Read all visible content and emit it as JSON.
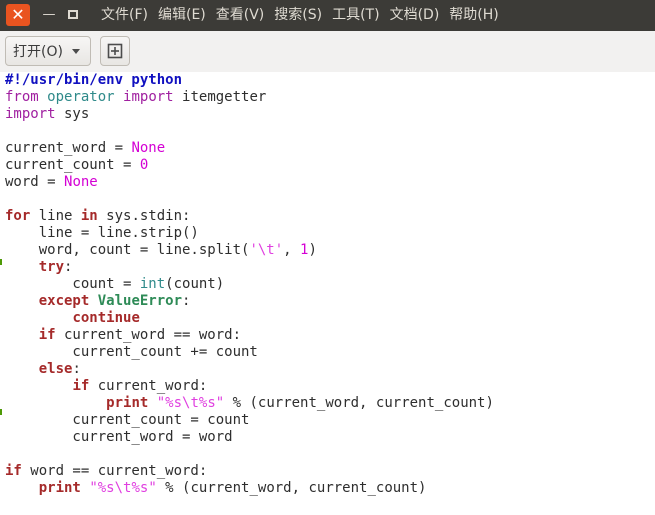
{
  "window": {
    "close_glyph": "✕",
    "minimize_glyph": "—"
  },
  "menu": [
    "文件(F)",
    "编辑(E)",
    "查看(V)",
    "搜索(S)",
    "工具(T)",
    "文档(D)",
    "帮助(H)"
  ],
  "toolbar": {
    "open_label": "打开(O)"
  },
  "editor": {
    "lines": [
      [
        {
          "t": "#!/usr/bin/env python",
          "c": "sb"
        }
      ],
      [
        {
          "t": "from",
          "c": "kw"
        },
        {
          "t": " "
        },
        {
          "t": "operator",
          "c": "bi"
        },
        {
          "t": " "
        },
        {
          "t": "import",
          "c": "kw"
        },
        {
          "t": " itemgetter"
        }
      ],
      [
        {
          "t": "import",
          "c": "kw"
        },
        {
          "t": " sys"
        }
      ],
      [],
      [
        {
          "t": "current_word = "
        },
        {
          "t": "None",
          "c": "num"
        }
      ],
      [
        {
          "t": "current_count = "
        },
        {
          "t": "0",
          "c": "num"
        }
      ],
      [
        {
          "t": "word = "
        },
        {
          "t": "None",
          "c": "num"
        }
      ],
      [],
      [
        {
          "t": "for",
          "c": "kwb"
        },
        {
          "t": " line "
        },
        {
          "t": "in",
          "c": "kwb"
        },
        {
          "t": " sys.stdin:"
        }
      ],
      [
        {
          "t": "    line = line.strip()"
        }
      ],
      [
        {
          "t": "    word, count = line.split("
        },
        {
          "t": "'\\t'",
          "c": "str"
        },
        {
          "t": ", "
        },
        {
          "t": "1",
          "c": "num"
        },
        {
          "t": ")"
        }
      ],
      [
        {
          "t": "    "
        },
        {
          "t": "try",
          "c": "kwb"
        },
        {
          "t": ":"
        }
      ],
      [
        {
          "t": "        count = "
        },
        {
          "t": "int",
          "c": "bi"
        },
        {
          "t": "(count)"
        }
      ],
      [
        {
          "t": "    "
        },
        {
          "t": "except",
          "c": "kwb"
        },
        {
          "t": " "
        },
        {
          "t": "ValueError",
          "c": "exc"
        },
        {
          "t": ":"
        }
      ],
      [
        {
          "t": "        "
        },
        {
          "t": "continue",
          "c": "kwb"
        }
      ],
      [
        {
          "t": "    "
        },
        {
          "t": "if",
          "c": "kwb"
        },
        {
          "t": " current_word == word:"
        }
      ],
      [
        {
          "t": "        current_count += count"
        }
      ],
      [
        {
          "t": "    "
        },
        {
          "t": "else",
          "c": "kwb"
        },
        {
          "t": ":"
        }
      ],
      [
        {
          "t": "        "
        },
        {
          "t": "if",
          "c": "kwb"
        },
        {
          "t": " current_word:"
        }
      ],
      [
        {
          "t": "            "
        },
        {
          "t": "print",
          "c": "kwb"
        },
        {
          "t": " "
        },
        {
          "t": "\"%s\\t%s\"",
          "c": "str"
        },
        {
          "t": " % (current_word, current_count)"
        }
      ],
      [
        {
          "t": "        current_count = count"
        }
      ],
      [
        {
          "t": "        current_word = word"
        }
      ],
      [],
      [
        {
          "t": "if",
          "c": "kwb"
        },
        {
          "t": " word == current_word:"
        }
      ],
      [
        {
          "t": "    "
        },
        {
          "t": "print",
          "c": "kwb"
        },
        {
          "t": " "
        },
        {
          "t": "\"%s\\t%s\"",
          "c": "str"
        },
        {
          "t": " % (current_word, current_count)"
        }
      ]
    ]
  }
}
